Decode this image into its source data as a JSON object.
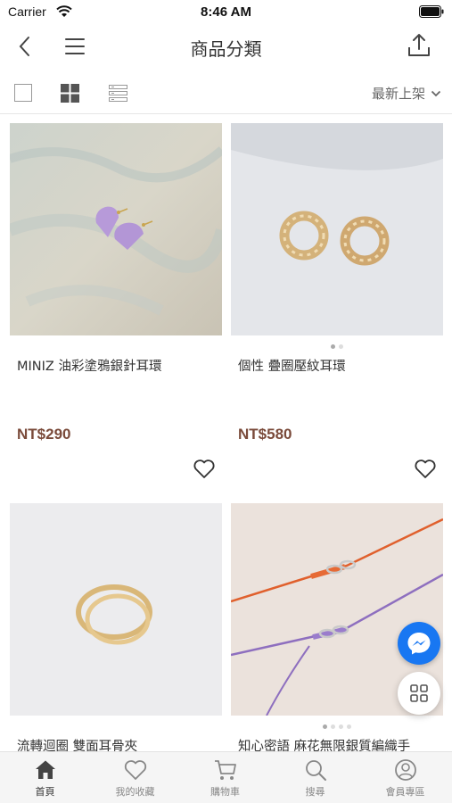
{
  "status_bar": {
    "carrier": "Carrier",
    "time": "8:46 AM"
  },
  "nav": {
    "title": "商品分類"
  },
  "toolbar": {
    "sort_label": "最新上架"
  },
  "products": [
    {
      "name": "MINIZ 油彩塗鴉銀針耳環",
      "price": "NT$290",
      "image": "lavender-heart-stud-earrings"
    },
    {
      "name": "個性 疊圈壓紋耳環",
      "price": "NT$580",
      "image": "gold-textured-hoop-earrings"
    },
    {
      "name": "流轉迴圈 雙面耳骨夾",
      "price": "",
      "image": "gold-ear-cuff"
    },
    {
      "name": "知心密語 麻花無限銀質編織手",
      "price": "",
      "image": "infinity-braided-bracelets"
    }
  ],
  "tabs": [
    {
      "label": "首頁",
      "icon": "home-icon",
      "active": true
    },
    {
      "label": "我的收藏",
      "icon": "heart-icon",
      "active": false
    },
    {
      "label": "購物車",
      "icon": "cart-icon",
      "active": false
    },
    {
      "label": "搜尋",
      "icon": "search-icon",
      "active": false
    },
    {
      "label": "會員專區",
      "icon": "user-icon",
      "active": false
    }
  ],
  "colors": {
    "price": "#7a4a3a",
    "messenger": "#1877f2",
    "tab_active": "#333333",
    "tab_inactive": "#888888"
  }
}
